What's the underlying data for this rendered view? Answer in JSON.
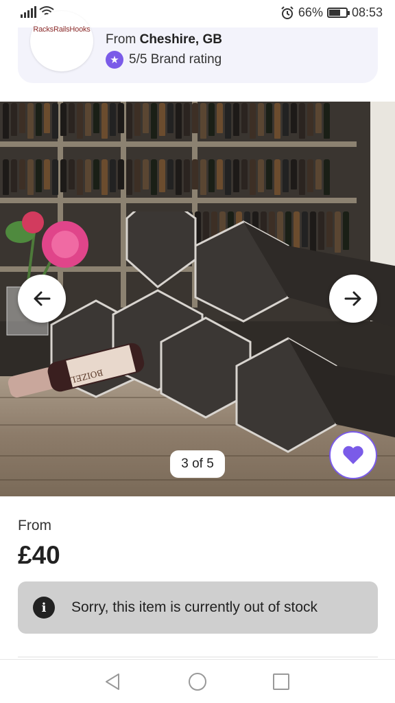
{
  "status_bar": {
    "battery_percent_text": "66%",
    "battery_level": 0.66,
    "time": "08:53",
    "icons": [
      "signal-icon",
      "wifi-icon",
      "alarm-icon",
      "battery-icon"
    ]
  },
  "seller": {
    "logo_text": "RacksRailsHooks",
    "origin_prefix": "From",
    "origin_place": "Cheshire, GB",
    "rating_text": "5/5 Brand rating",
    "accent_color": "#7a5be8"
  },
  "gallery": {
    "counter": "3 of 5",
    "prev_icon": "arrow-left-icon",
    "next_icon": "arrow-right-icon",
    "favorite_icon": "heart-icon",
    "bottle_label": "BOIZEL"
  },
  "product": {
    "from_label": "From",
    "price": "£40"
  },
  "stock_notice": {
    "icon": "info-icon",
    "message": "Sorry, this item is currently out of stock"
  },
  "android_nav": {
    "icons": [
      "back-triangle-icon",
      "home-circle-icon",
      "recents-square-icon"
    ]
  }
}
